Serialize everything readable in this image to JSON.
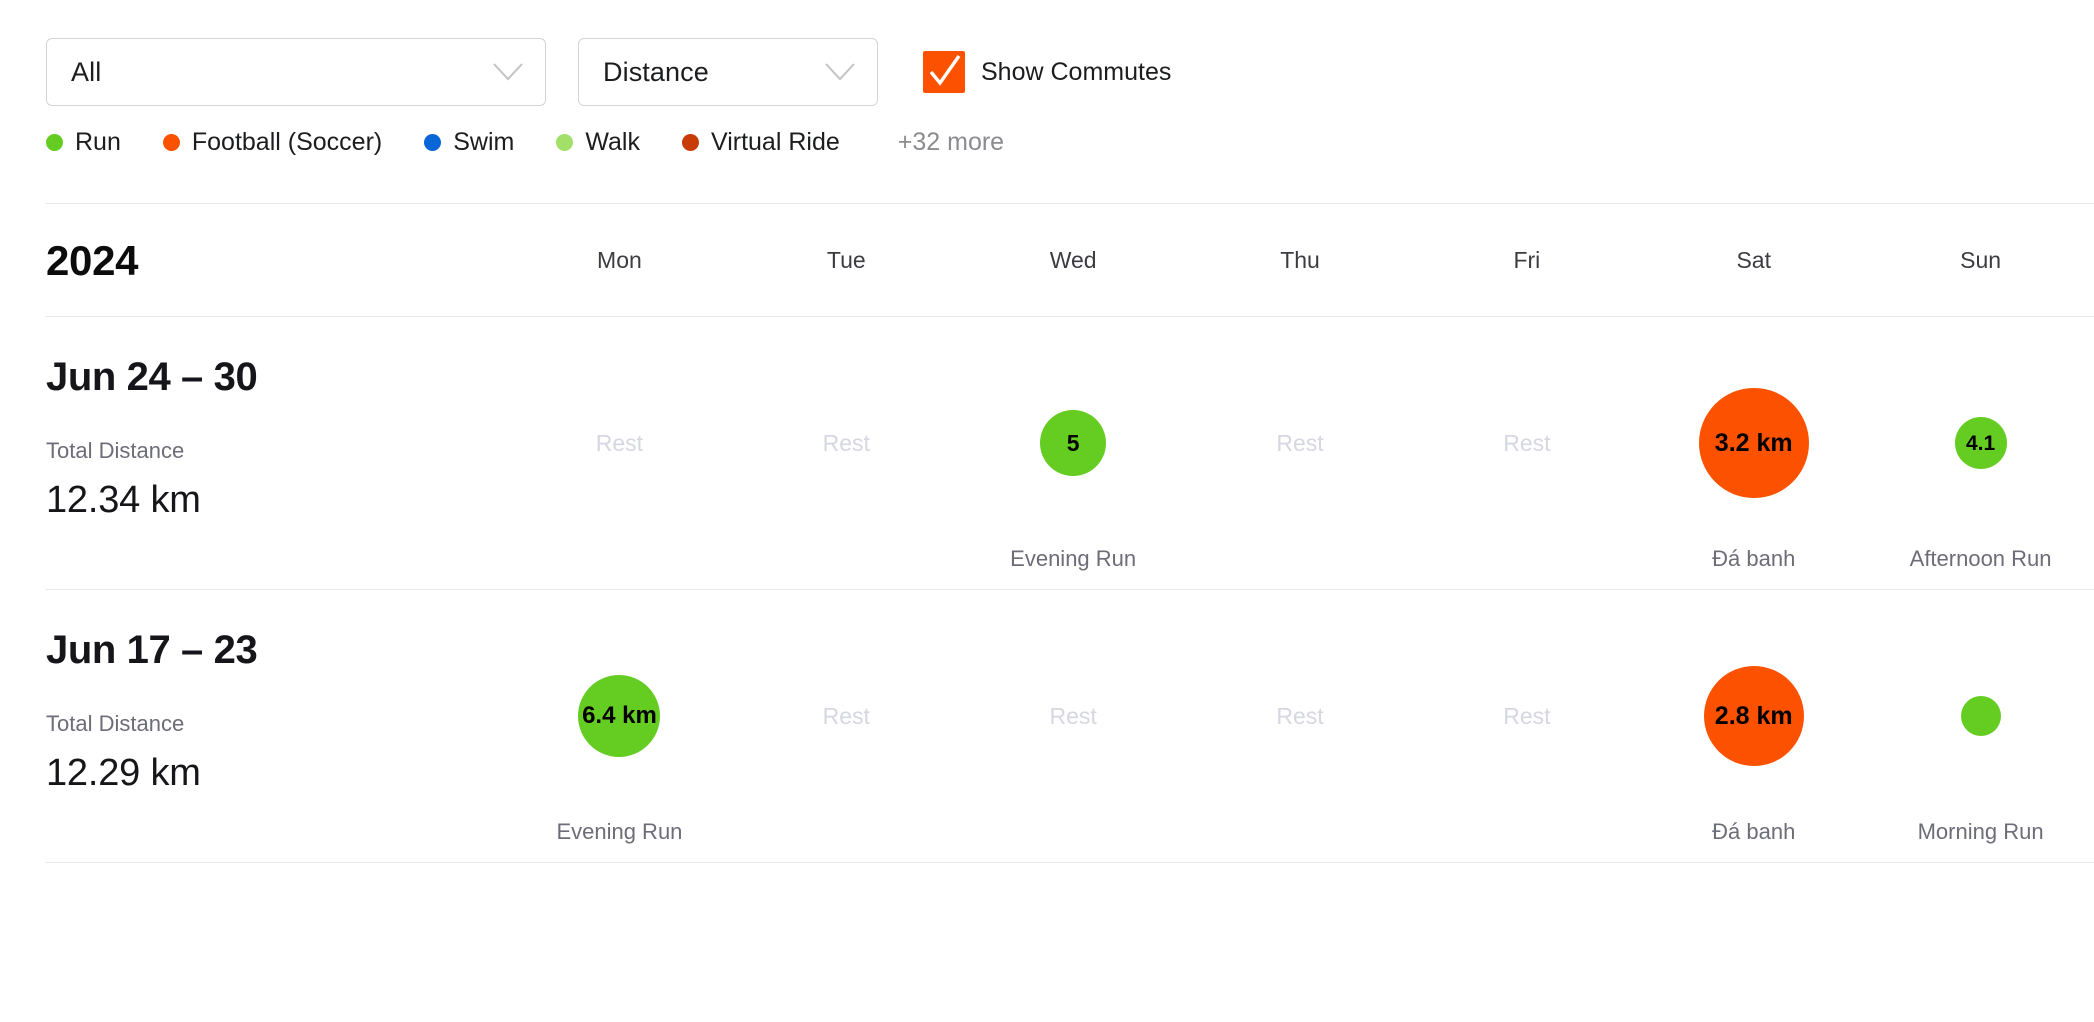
{
  "filters": {
    "sport_select": {
      "value": "All",
      "icon": "chevron-down-icon"
    },
    "metric_select": {
      "value": "Distance",
      "icon": "chevron-down-icon"
    },
    "show_commutes": {
      "label": "Show Commutes",
      "checked": true,
      "color": "#fc5200",
      "icon": "check-icon"
    }
  },
  "legend": {
    "items": [
      {
        "label": "Run",
        "color": "#65cc22"
      },
      {
        "label": "Football (Soccer)",
        "color": "#fc5200"
      },
      {
        "label": "Swim",
        "color": "#0a66d6"
      },
      {
        "label": "Walk",
        "color": "#a2e06a"
      },
      {
        "label": "Virtual Ride",
        "color": "#c83a06"
      }
    ],
    "more_label": "+32 more"
  },
  "header": {
    "year": "2024",
    "days": [
      "Mon",
      "Tue",
      "Wed",
      "Thu",
      "Fri",
      "Sat",
      "Sun"
    ]
  },
  "rest_label": "Rest",
  "weeks": [
    {
      "title": "Jun 24 – 30",
      "metric_label": "Total Distance",
      "metric_value": "12.34 km",
      "days": [
        {
          "type": "rest"
        },
        {
          "type": "rest"
        },
        {
          "type": "activity",
          "value": "5",
          "name": "Evening Run",
          "color": "#65cc22",
          "size": 66
        },
        {
          "type": "rest"
        },
        {
          "type": "rest"
        },
        {
          "type": "activity",
          "value": "3.2 km",
          "name": "Đá banh",
          "color": "#fc5200",
          "size": 110
        },
        {
          "type": "activity",
          "value": "4.1",
          "name": "Afternoon Run",
          "color": "#65cc22",
          "size": 52
        }
      ]
    },
    {
      "title": "Jun 17 – 23",
      "metric_label": "Total Distance",
      "metric_value": "12.29 km",
      "days": [
        {
          "type": "activity",
          "value": "6.4 km",
          "name": "Evening Run",
          "color": "#65cc22",
          "size": 82
        },
        {
          "type": "rest"
        },
        {
          "type": "rest"
        },
        {
          "type": "rest"
        },
        {
          "type": "rest"
        },
        {
          "type": "activity",
          "value": "2.8 km",
          "name": "Đá banh",
          "color": "#fc5200",
          "size": 100
        },
        {
          "type": "activity",
          "value": "",
          "name": "Morning Run",
          "color": "#65cc22",
          "size": 40
        }
      ]
    }
  ]
}
